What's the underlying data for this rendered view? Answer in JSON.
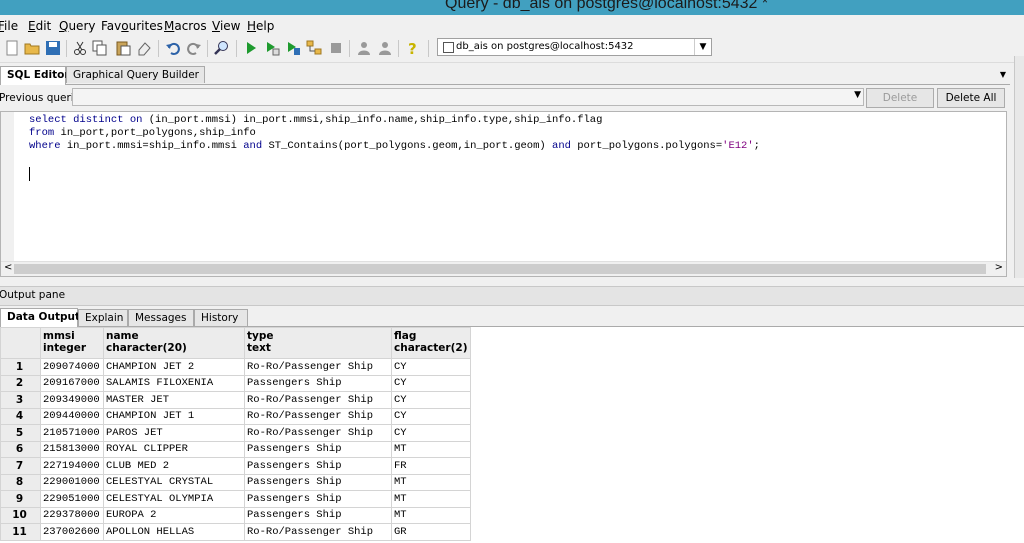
{
  "window": {
    "title": "Query - db_ais on postgres@localhost:5432 *"
  },
  "menu": {
    "items": [
      {
        "label": "File",
        "mnemonic": "F"
      },
      {
        "label": "Edit",
        "mnemonic": "E"
      },
      {
        "label": "Query",
        "mnemonic": "Q"
      },
      {
        "label": "Favourites",
        "mnemonic": "o"
      },
      {
        "label": "Macros",
        "mnemonic": "M"
      },
      {
        "label": "View",
        "mnemonic": "V"
      },
      {
        "label": "Help",
        "mnemonic": "H"
      }
    ]
  },
  "toolbar": {
    "connection": "db_ais on postgres@localhost:5432",
    "icons": [
      "new-icon",
      "open-icon",
      "save-icon",
      "cut-icon",
      "copy-icon",
      "paste-icon",
      "clear-icon",
      "undo-icon",
      "redo-icon",
      "find-icon",
      "execute-icon",
      "execute-pgscript-icon",
      "execute-to-file-icon",
      "explain-icon",
      "cancel-icon",
      "commit-icon",
      "rollback-icon",
      "help-icon"
    ]
  },
  "editor_tabs": [
    {
      "label": "SQL Editor",
      "active": true
    },
    {
      "label": "Graphical Query Builder",
      "active": false
    }
  ],
  "previous_queries": {
    "label": "Previous queries",
    "value": "",
    "delete_label": "Delete",
    "delete_all_label": "Delete All"
  },
  "sql": {
    "line1": {
      "kw1": "select distinct on",
      "rest": " (in_port.mmsi) in_port.mmsi,ship_info.name,ship_info.type,ship_info.flag"
    },
    "line2": {
      "kw1": "from",
      "rest": " in_port,port_polygons,ship_info"
    },
    "line3": {
      "kw1": "where",
      "mid1": " in_port.mmsi=ship_info.mmsi ",
      "kw2": "and",
      "mid2": " ST_Contains(port_polygons.geom,in_port.geom) ",
      "kw3": "and",
      "mid3": " port_polygons.polygons=",
      "str": "'E12'",
      "end": ";"
    }
  },
  "output": {
    "pane_label": "Output pane",
    "tabs": [
      {
        "label": "Data Output",
        "active": true
      },
      {
        "label": "Explain",
        "active": false
      },
      {
        "label": "Messages",
        "active": false
      },
      {
        "label": "History",
        "active": false
      }
    ],
    "columns": [
      {
        "name": "mmsi",
        "type": "integer"
      },
      {
        "name": "name",
        "type": "character(20)"
      },
      {
        "name": "type",
        "type": "text"
      },
      {
        "name": "flag",
        "type": "character(2)"
      }
    ],
    "rows": [
      [
        "1",
        "209074000",
        "CHAMPION JET 2",
        "Ro-Ro/Passenger Ship",
        "CY"
      ],
      [
        "2",
        "209167000",
        "SALAMIS FILOXENIA",
        "Passengers Ship",
        "CY"
      ],
      [
        "3",
        "209349000",
        "MASTER JET",
        "Ro-Ro/Passenger Ship",
        "CY"
      ],
      [
        "4",
        "209440000",
        "CHAMPION JET 1",
        "Ro-Ro/Passenger Ship",
        "CY"
      ],
      [
        "5",
        "210571000",
        "PAROS JET",
        "Ro-Ro/Passenger Ship",
        "CY"
      ],
      [
        "6",
        "215813000",
        "ROYAL CLIPPER",
        "Passengers Ship",
        "MT"
      ],
      [
        "7",
        "227194000",
        "CLUB MED 2",
        "Passengers Ship",
        "FR"
      ],
      [
        "8",
        "229001000",
        "CELESTYAL CRYSTAL",
        "Passengers Ship",
        "MT"
      ],
      [
        "9",
        "229051000",
        "CELESTYAL OLYMPIA",
        "Passengers Ship",
        "MT"
      ],
      [
        "10",
        "229378000",
        "EUROPA 2",
        "Passengers Ship",
        "MT"
      ],
      [
        "11",
        "237002600",
        "APOLLON HELLAS",
        "Ro-Ro/Passenger Ship",
        "GR"
      ]
    ]
  }
}
